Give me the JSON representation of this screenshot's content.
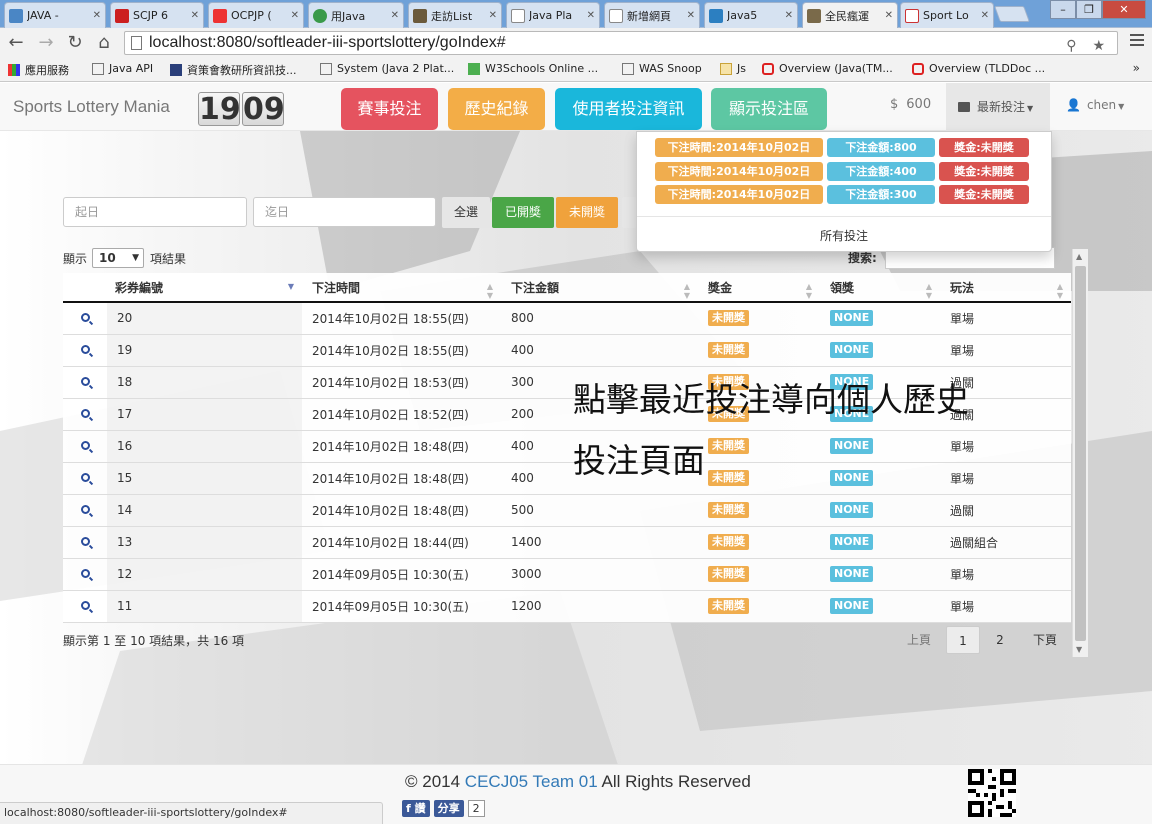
{
  "browser": {
    "tabs": [
      {
        "label": "JAVA - ",
        "active": false
      },
      {
        "label": "SCJP 6 ",
        "active": false
      },
      {
        "label": "OCPJP (",
        "active": false
      },
      {
        "label": "用Java",
        "active": false
      },
      {
        "label": "走訪List",
        "active": false
      },
      {
        "label": "Java Pla",
        "active": false
      },
      {
        "label": "新增網頁",
        "active": false
      },
      {
        "label": "Java5",
        "active": false
      },
      {
        "label": "全民瘋運",
        "active": true
      },
      {
        "label": "Sport Lo",
        "active": false
      }
    ],
    "url": "localhost:8080/softleader-iii-sportslottery/goIndex#",
    "bookmarks": [
      "應用服務",
      "Java API",
      "資策會教研所資訊技...",
      "System (Java 2 Plat...",
      "W3Schools Online ...",
      "WAS Snoop",
      "Js",
      "Overview (Java(TM...",
      "Overview (TLDDoc ..."
    ],
    "bookmarks_more": "»",
    "status_url": "localhost:8080/softleader-iii-sportslottery/goIndex#"
  },
  "navbar": {
    "brand": "Sports Lottery Mania",
    "clock": [
      "19",
      "09"
    ],
    "buttons": [
      {
        "label": "賽事投注",
        "color": "#e5535f"
      },
      {
        "label": "歷史紀錄",
        "color": "#f3ad47"
      },
      {
        "label": "使用者投注資訊",
        "color": "#1ab7db"
      },
      {
        "label": "顯示投注區",
        "color": "#5dc7a3"
      }
    ],
    "balance": "600",
    "latest_bets_label": "最新投注",
    "username": "chen"
  },
  "latest_dropdown": {
    "items": [
      {
        "time": "下注時間:2014年10月02日",
        "amount": "下注金額:800",
        "prize": "獎金:未開獎"
      },
      {
        "time": "下注時間:2014年10月02日",
        "amount": "下注金額:400",
        "prize": "獎金:未開獎"
      },
      {
        "time": "下注時間:2014年10月02日",
        "amount": "下注金額:300",
        "prize": "獎金:未開獎"
      }
    ],
    "all_bets_link": "所有投注"
  },
  "filters": {
    "start_date_placeholder": "起日",
    "end_date_placeholder": "迄日",
    "all_label": "全選",
    "drawn_label": "已開獎",
    "undrawn_label": "未開獎"
  },
  "table": {
    "length_prefix": "顯示",
    "length_value": "10",
    "length_suffix": "項結果",
    "search_label": "搜索:",
    "headers": [
      "彩券編號",
      "下注時間",
      "下注金額",
      "獎金",
      "領獎",
      "玩法"
    ],
    "rows": [
      {
        "id": "20",
        "time": "2014年10月02日 18:55(四)",
        "amount": "800",
        "prize": "未開獎",
        "claim": "NONE",
        "type": "單場"
      },
      {
        "id": "19",
        "time": "2014年10月02日 18:55(四)",
        "amount": "400",
        "prize": "未開獎",
        "claim": "NONE",
        "type": "單場"
      },
      {
        "id": "18",
        "time": "2014年10月02日 18:53(四)",
        "amount": "300",
        "prize": "未開獎",
        "claim": "NONE",
        "type": "過關"
      },
      {
        "id": "17",
        "time": "2014年10月02日 18:52(四)",
        "amount": "200",
        "prize": "未開獎",
        "claim": "NONE",
        "type": "過關"
      },
      {
        "id": "16",
        "time": "2014年10月02日 18:48(四)",
        "amount": "400",
        "prize": "未開獎",
        "claim": "NONE",
        "type": "單場"
      },
      {
        "id": "15",
        "time": "2014年10月02日 18:48(四)",
        "amount": "400",
        "prize": "未開獎",
        "claim": "NONE",
        "type": "單場"
      },
      {
        "id": "14",
        "time": "2014年10月02日 18:48(四)",
        "amount": "500",
        "prize": "未開獎",
        "claim": "NONE",
        "type": "過關"
      },
      {
        "id": "13",
        "time": "2014年10月02日 18:44(四)",
        "amount": "1400",
        "prize": "未開獎",
        "claim": "NONE",
        "type": "過關組合"
      },
      {
        "id": "12",
        "time": "2014年09月05日 10:30(五)",
        "amount": "3000",
        "prize": "未開獎",
        "claim": "NONE",
        "type": "單場"
      },
      {
        "id": "11",
        "time": "2014年09月05日 10:30(五)",
        "amount": "1200",
        "prize": "未開獎",
        "claim": "NONE",
        "type": "單場"
      }
    ],
    "info": "顯示第 1 至 10 項結果，共 16 項",
    "pager": {
      "prev": "上頁",
      "pages": [
        "1",
        "2"
      ],
      "next": "下頁"
    }
  },
  "annotation": {
    "line1": "點擊最近投注導向個人歷史",
    "line2": "投注頁面"
  },
  "footer": {
    "copyright_prefix": "© 2014 ",
    "team": "CECJ05 Team 01",
    "copyright_suffix": " All Rights Reserved",
    "like_label": "f 讚",
    "share_label": "分享",
    "share_count": "2"
  }
}
